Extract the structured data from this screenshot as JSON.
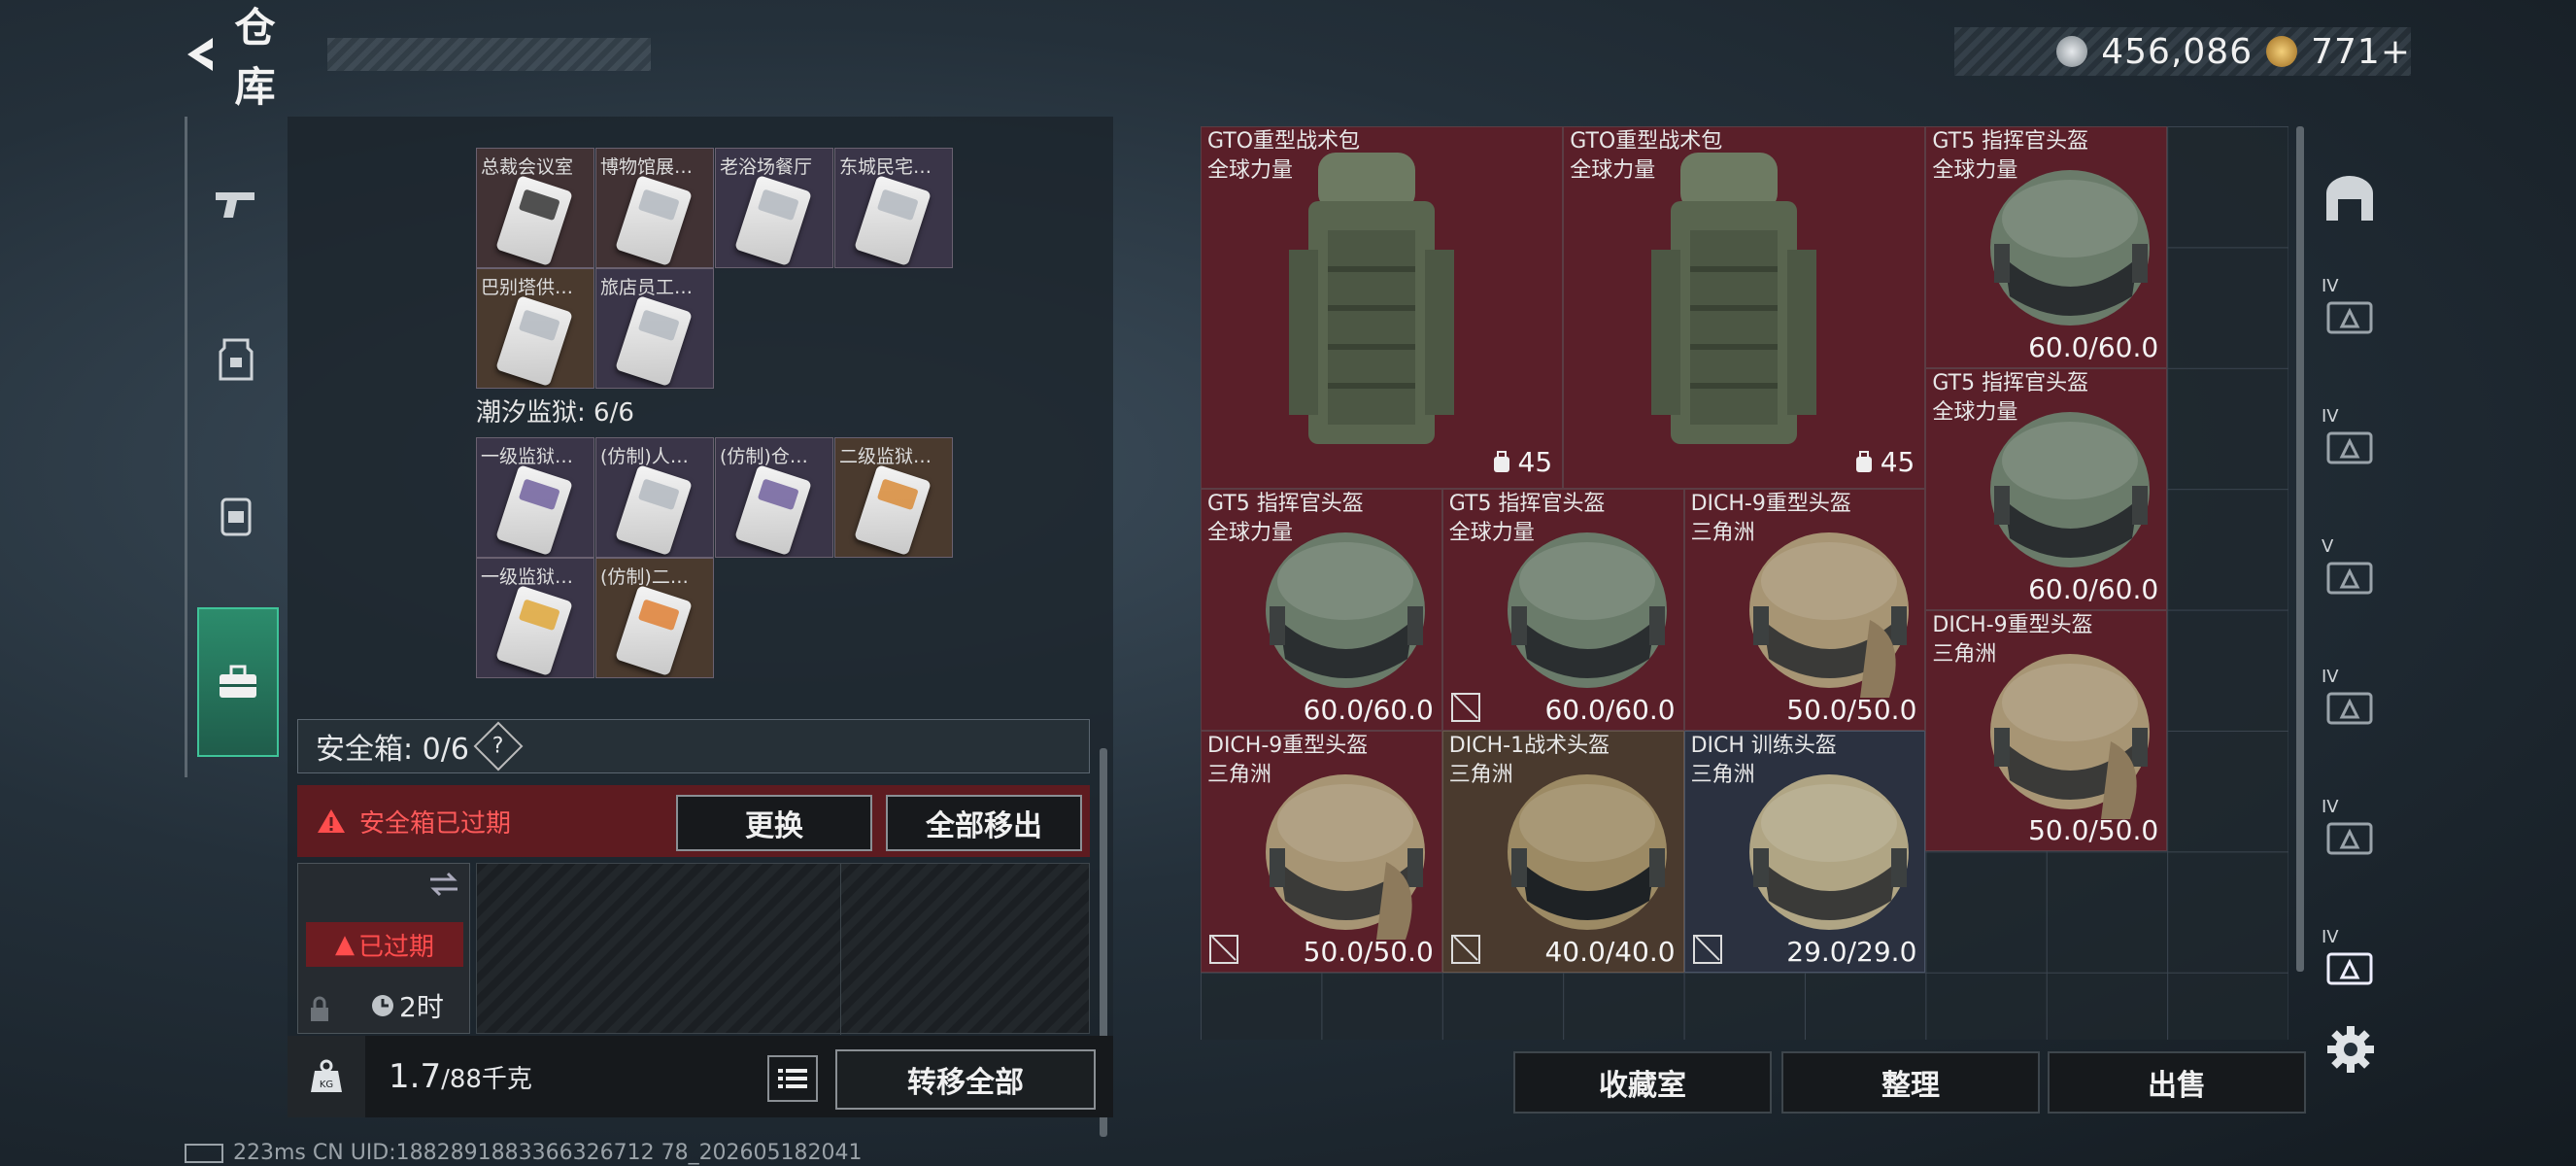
{
  "header": {
    "title": "仓库",
    "currency": [
      {
        "icon": "silver-coin-icon",
        "value": "456,086",
        "color": "#c7cdd2"
      },
      {
        "icon": "gold-coin-icon",
        "value": "771+",
        "color": "#d8a94a"
      }
    ]
  },
  "left_panel": {
    "group1_tiles": [
      {
        "label": "总裁会议室",
        "card_color": "#2b2b2b",
        "tint": "red"
      },
      {
        "label": "博物馆展…",
        "card_color": "#b0b6be",
        "tint": "red"
      },
      {
        "label": "老浴场餐厅",
        "card_color": "#b0b6be",
        "tint": "purple"
      },
      {
        "label": "东城民宅…",
        "card_color": "#b0b6be",
        "tint": "purple"
      },
      {
        "label": "巴别塔供…",
        "card_color": "#b0b6be",
        "tint": "brown"
      },
      {
        "label": "旅店员工…",
        "card_color": "#b0b6be",
        "tint": "purple"
      }
    ],
    "section2_title": "潮汐监狱: 6/6",
    "group2_tiles": [
      {
        "label": "一级监狱…",
        "card_color": "#6a5a9a",
        "tint": "purple"
      },
      {
        "label": "(仿制)人…",
        "card_color": "#b0b6be",
        "tint": "purple"
      },
      {
        "label": "(仿制)仓…",
        "card_color": "#6a5a9a",
        "tint": "purple"
      },
      {
        "label": "二级监狱…",
        "card_color": "#d8862e",
        "tint": "brown"
      },
      {
        "label": "一级监狱…",
        "card_color": "#e0a430",
        "tint": "purple"
      },
      {
        "label": "(仿制)二…",
        "card_color": "#e07a2a",
        "tint": "brown"
      }
    ],
    "safe_box": {
      "title": "安全箱: 0/6",
      "help": "?",
      "warning": "安全箱已过期",
      "replace_label": "更换",
      "remove_all_label": "全部移出",
      "case_status": "已过期",
      "case_timer": "2时"
    },
    "weight": {
      "current": "1.7",
      "max": "/88千克"
    },
    "transfer_all_label": "转移全部"
  },
  "grid_items": [
    {
      "name": "GTO重型战术包",
      "sub": "全球力量",
      "capacity": "45",
      "kind": "backpack"
    },
    {
      "name": "GTO重型战术包",
      "sub": "全球力量",
      "capacity": "45",
      "kind": "backpack"
    },
    {
      "name": "GT5 指挥官头盔",
      "sub": "全球力量",
      "durability": "60.0/60.0",
      "kind": "helmet-gt5"
    },
    {
      "name": "GT5 指挥官头盔",
      "sub": "全球力量",
      "durability": "60.0/60.0",
      "kind": "helmet-gt5"
    },
    {
      "name": "GT5 指挥官头盔",
      "sub": "全球力量",
      "durability": "60.0/60.0",
      "kind": "helmet-gt5"
    },
    {
      "name": "GT5 指挥官头盔",
      "sub": "全球力量",
      "durability": "60.0/60.0",
      "kind": "helmet-gt5"
    },
    {
      "name": "DICH-9重型头盔",
      "sub": "三角洲",
      "durability": "50.0/50.0",
      "kind": "helmet-dich9"
    },
    {
      "name": "DICH-9重型头盔",
      "sub": "三角洲",
      "durability": "50.0/50.0",
      "kind": "helmet-dich9"
    },
    {
      "name": "DICH-9重型头盔",
      "sub": "三角洲",
      "durability": "50.0/50.0",
      "kind": "helmet-dich9"
    },
    {
      "name": "DICH-1战术头盔",
      "sub": "三角洲",
      "durability": "40.0/40.0",
      "kind": "helmet-dich1"
    },
    {
      "name": "DICH 训练头盔",
      "sub": "三角洲",
      "durability": "29.0/29.0",
      "kind": "helmet-train"
    }
  ],
  "bottom_buttons": {
    "collection": "收藏室",
    "sort": "整理",
    "sell": "出售"
  },
  "right_tabs": [
    "IV",
    "IV",
    "V",
    "IV",
    "IV",
    "IV"
  ],
  "footer": "223ms    CN UID:1882891883366326712 78_202605182041"
}
